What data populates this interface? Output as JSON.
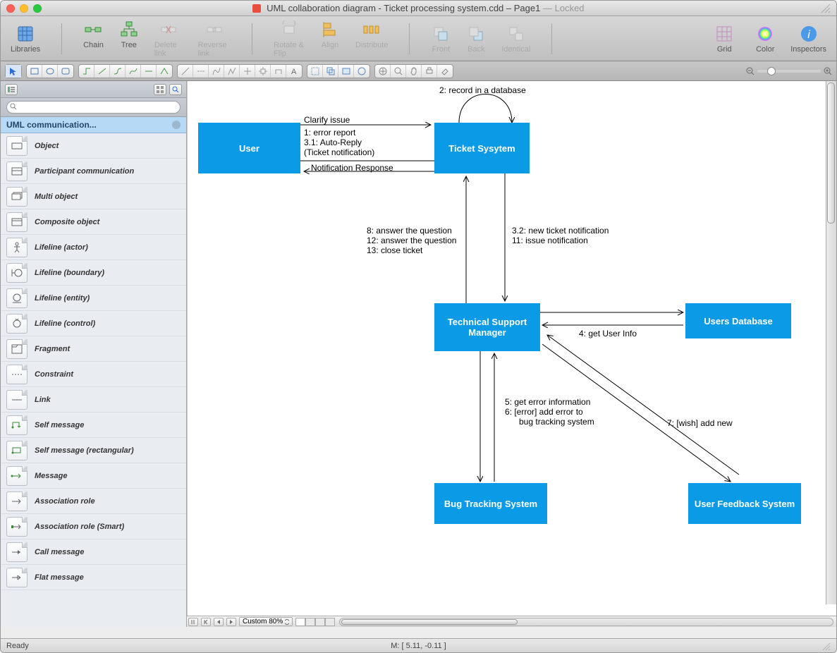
{
  "title": {
    "doc": "UML collaboration diagram - Ticket processing system.cdd",
    "page": "Page1",
    "locked": "Locked"
  },
  "toolbar": [
    {
      "label": "Libraries",
      "icon": "libraries",
      "disabled": false
    },
    {
      "label": "Chain",
      "icon": "chain",
      "disabled": false
    },
    {
      "label": "Tree",
      "icon": "tree",
      "disabled": false
    },
    {
      "label": "Delete link",
      "icon": "delete",
      "disabled": true
    },
    {
      "label": "Reverse link",
      "icon": "reverse",
      "disabled": true
    },
    {
      "label": "Rotate & Flip",
      "icon": "rotate",
      "disabled": true
    },
    {
      "label": "Align",
      "icon": "align",
      "disabled": true
    },
    {
      "label": "Distribute",
      "icon": "distribute",
      "disabled": true
    },
    {
      "label": "Front",
      "icon": "front",
      "disabled": true
    },
    {
      "label": "Back",
      "icon": "back",
      "disabled": true
    },
    {
      "label": "Identical",
      "icon": "identical",
      "disabled": true
    },
    {
      "label": "Grid",
      "icon": "grid",
      "disabled": false
    },
    {
      "label": "Color",
      "icon": "color",
      "disabled": false
    },
    {
      "label": "Inspectors",
      "icon": "info",
      "disabled": false
    }
  ],
  "sidebar": {
    "category": "UML communication...",
    "items": [
      {
        "label": "Object",
        "icon": "rect"
      },
      {
        "label": "Participant communication",
        "icon": "rect2"
      },
      {
        "label": "Multi object",
        "icon": "multi"
      },
      {
        "label": "Composite object",
        "icon": "composite"
      },
      {
        "label": "Lifeline (actor)",
        "icon": "actor"
      },
      {
        "label": "Lifeline (boundary)",
        "icon": "boundary"
      },
      {
        "label": "Lifeline (entity)",
        "icon": "entity"
      },
      {
        "label": "Lifeline (control)",
        "icon": "control"
      },
      {
        "label": "Fragment",
        "icon": "fragment"
      },
      {
        "label": "Constraint",
        "icon": "constraint"
      },
      {
        "label": "Link",
        "icon": "link"
      },
      {
        "label": "Self message",
        "icon": "selfmsg"
      },
      {
        "label": "Self message (rectangular)",
        "icon": "selfmsgr"
      },
      {
        "label": "Message",
        "icon": "msg"
      },
      {
        "label": "Association role",
        "icon": "assoc"
      },
      {
        "label": "Association role (Smart)",
        "icon": "assocs"
      },
      {
        "label": "Call message",
        "icon": "call"
      },
      {
        "label": "Flat message",
        "icon": "flat"
      }
    ]
  },
  "diagram": {
    "nodes": {
      "user": "User",
      "ticket": "Ticket Sysytem",
      "tsm": "Technical Support Manager",
      "bug": "Bug Tracking System",
      "udb": "Users Database",
      "ufs": "User Feedback System"
    },
    "labels": {
      "clarify": "Clarify issue",
      "l1": "1: error report",
      "l31": "3.1: Auto-Reply",
      "l31b": "(Ticket notification)",
      "notif": "Notification Response",
      "rec": "2: record in a database",
      "l8": "8: answer the question",
      "l12": "12: answer the question",
      "l13": "13: close ticket",
      "l32": "3.2: new ticket notification",
      "l11": "11: issue notification",
      "l4": "4: get User Info",
      "l5": "5: get error information",
      "l6": "6: [error] add error to",
      "l6b": "      bug tracking system",
      "l7": "7: [wish] add new"
    }
  },
  "footer": {
    "zoom": "Custom 80%",
    "status": "Ready",
    "mouse": "M: [ 5.11, -0.11 ]"
  }
}
